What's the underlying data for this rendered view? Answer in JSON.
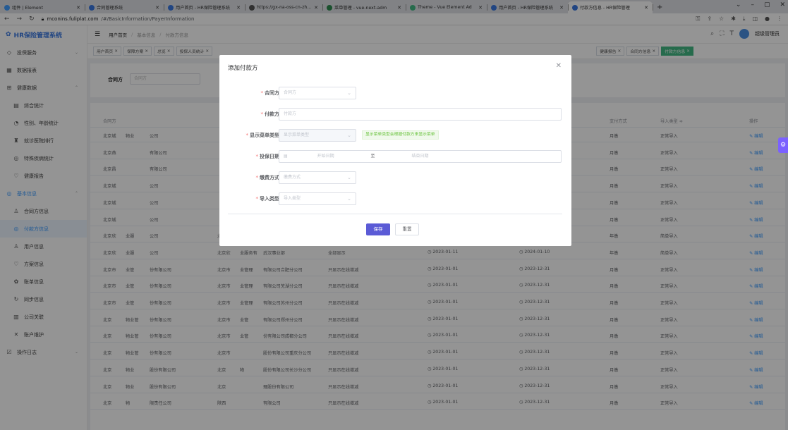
{
  "browser": {
    "tabs": [
      {
        "label": "组件 | Element",
        "color": "#409eff"
      },
      {
        "label": "合同管理系统",
        "color": "#3a78e0"
      },
      {
        "label": "用户首页 - HR保险管理系统",
        "color": "#3a78e0"
      },
      {
        "label": "https://gx-na-oss-cn-zh...",
        "color": "#555555"
      },
      {
        "label": "菜单管理 - vue-next-adm",
        "color": "#2d8a4e"
      },
      {
        "label": "Theme - Vue Element Ad",
        "color": "#42b983"
      },
      {
        "label": "用户首页 - HR保险管理系统",
        "color": "#3a78e0"
      },
      {
        "label": "付款方信息 - HR保险管理",
        "color": "#3a78e0"
      }
    ],
    "url_host": "mconins.fuliplat.com",
    "url_path": "/#/BasicInformation/PayerInformation"
  },
  "app": {
    "logo": "HR保险管理系统",
    "breadcrumb": [
      "用户首页",
      "基本信息",
      "付款方信息"
    ],
    "username": "超级管理员"
  },
  "sidebar": [
    {
      "label": "投保服务",
      "icon": "◇",
      "top": true,
      "chev": "⌄"
    },
    {
      "label": "数据报表",
      "icon": "▦",
      "top": true
    },
    {
      "label": "健康数据",
      "icon": "⊞",
      "top": true,
      "chev": "⌃"
    },
    {
      "label": "综合统计",
      "icon": "▤"
    },
    {
      "label": "性别、年龄统计",
      "icon": "◔"
    },
    {
      "label": "就诊医院排行",
      "icon": "♜"
    },
    {
      "label": "特殊疾病统计",
      "icon": "◎"
    },
    {
      "label": "健康报告",
      "icon": "♡"
    },
    {
      "label": "基本信息",
      "icon": "◎",
      "top": true,
      "chev": "⌃",
      "open": true
    },
    {
      "label": "合同方信息",
      "icon": "♙"
    },
    {
      "label": "付款方信息",
      "icon": "◎",
      "active": true
    },
    {
      "label": "用户信息",
      "icon": "♙"
    },
    {
      "label": "方案信息",
      "icon": "♡"
    },
    {
      "label": "账单信息",
      "icon": "✿"
    },
    {
      "label": "同步信息",
      "icon": "↻"
    },
    {
      "label": "公司关联",
      "icon": "▥"
    },
    {
      "label": "账户维护",
      "icon": "✕"
    },
    {
      "label": "操作日志",
      "icon": "☑",
      "top": true,
      "chev": "⌄"
    }
  ],
  "pagetags": [
    "用户首页",
    "保障方案",
    "总览",
    "投保人员统计"
  ],
  "pagetags_right": [
    "健康报告",
    "合同方信息"
  ],
  "pagetag_active": "付款方信息",
  "filter": {
    "label": "合同方",
    "placeholder": "合同方"
  },
  "table": {
    "headers": {
      "contract": "合同方",
      "pay": "支付方式",
      "import": "导入类型 ≑",
      "op": "操作"
    },
    "rows": [
      [
        "北京城",
        "物业",
        "公司",
        "",
        "",
        "",
        "",
        "月缴",
        "正常导入"
      ],
      [
        "北京燕",
        "",
        "有限公司",
        "",
        "",
        "",
        "",
        "月缴",
        "正常导入"
      ],
      [
        "北京昌",
        "",
        "有限公司",
        "",
        "",
        "",
        "",
        "月缴",
        "正常导入"
      ],
      [
        "北京城",
        "",
        "公司",
        "",
        "",
        "",
        "",
        "月缴",
        "正常导入"
      ],
      [
        "北京城",
        "",
        "公司",
        "",
        "",
        "",
        "",
        "月缴",
        "正常导入"
      ],
      [
        "北京城",
        "",
        "公司",
        "",
        "",
        "",
        "",
        "月缴",
        "正常导入"
      ],
      [
        "北京欣",
        "业服",
        "公司",
        "北京欣",
        "业服务有",
        "司-中邮项目",
        "全部显示",
        "2023-01-11",
        "2024-01-10",
        "年缴",
        "简单导入"
      ],
      [
        "北京欣",
        "业服",
        "公司",
        "北京欣",
        "业服务有",
        "武汉事业部",
        "全部显示",
        "2023-01-11",
        "2024-01-10",
        "年缴",
        "简单导入"
      ],
      [
        "北京市",
        "业管",
        "份有限公司",
        "北京市",
        "业管理",
        "有限公司合肥分公司",
        "只显示在线增减",
        "2023-01-01",
        "2023-12-31",
        "月缴",
        "正常导入"
      ],
      [
        "北京市",
        "业管",
        "份有限公司",
        "北京市",
        "业管理",
        "有限公司芜湖分公司",
        "只显示在线增减",
        "2023-01-01",
        "2023-12-31",
        "月缴",
        "正常导入"
      ],
      [
        "北京市",
        "业管",
        "份有限公司",
        "北京市",
        "业管理",
        "有限公司苏州分公司",
        "只显示在线增减",
        "2023-01-01",
        "2023-12-31",
        "月缴",
        "正常导入"
      ],
      [
        "北京",
        "物业管",
        "份有限公司",
        "北京市",
        "业管",
        "有限公司郑州分公司",
        "只显示在线增减",
        "2023-01-01",
        "2023-12-31",
        "月缴",
        "正常导入"
      ],
      [
        "北京",
        "物业管",
        "份有限公司",
        "北京市",
        "业管",
        "份有限公司成都分公司",
        "只显示在线增减",
        "2023-01-01",
        "2023-12-31",
        "月缴",
        "正常导入"
      ],
      [
        "北京",
        "物业管",
        "份有限公司",
        "北京市",
        "",
        "股份有限公司重庆分公司",
        "只显示在线增减",
        "2023-01-01",
        "2023-12-31",
        "月缴",
        "正常导入"
      ],
      [
        "北京",
        "物业",
        "股份有限公司",
        "北京",
        "物",
        "股份有限公司长沙分公司",
        "只显示在线增减",
        "2023-01-01",
        "2023-12-31",
        "月缴",
        "正常导入"
      ],
      [
        "北京",
        "物业",
        "股份有限公司",
        "北京",
        "",
        "理股份有限公司",
        "只显示在线增减",
        "2023-01-01",
        "2023-12-31",
        "月缴",
        "正常导入"
      ],
      [
        "北京",
        "物",
        "限责任公司",
        "陕西",
        "",
        "有限公司",
        "只显示在线增减",
        "2023-01-01",
        "2023-12-31",
        "月缴",
        "正常导入"
      ]
    ],
    "op_label": "编辑"
  },
  "dialog": {
    "title": "添加付款方",
    "fields": {
      "contract": {
        "label": "合同方",
        "placeholder": "合同方"
      },
      "payer": {
        "label": "付款方",
        "placeholder": "付款方"
      },
      "menu_type": {
        "label": "显示菜单类型",
        "placeholder": "显示菜单类型",
        "hint": "显示菜单类型会根据付款方来显示菜单"
      },
      "date": {
        "label": "投保日期",
        "start": "开始日期",
        "sep": "至",
        "end": "结束日期"
      },
      "pay_method": {
        "label": "缴费方式",
        "placeholder": "缴费方式"
      },
      "import_type": {
        "label": "导入类型",
        "placeholder": "导入类型"
      }
    },
    "save": "保存",
    "reset": "重置"
  }
}
